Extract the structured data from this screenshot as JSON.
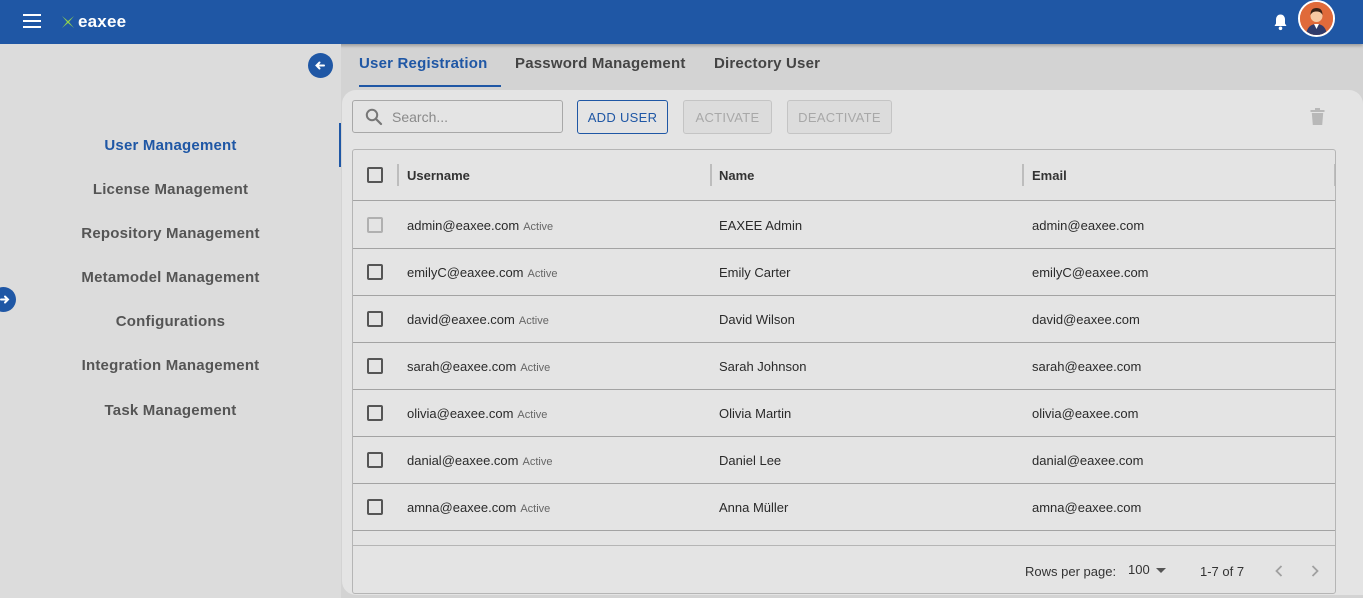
{
  "app": {
    "logo_text": "eaxee",
    "brand_color": "#1f57a5",
    "logo_mark_color": "#8fd14f"
  },
  "topbar": {
    "menu_icon": "hamburger-menu-icon",
    "notifications_icon": "bell-icon",
    "avatar_icon": "user-avatar"
  },
  "sidebar": {
    "items": [
      {
        "label": "User Management",
        "active": true
      },
      {
        "label": "License Management"
      },
      {
        "label": "Repository Management"
      },
      {
        "label": "Metamodel Management"
      },
      {
        "label": "Configurations"
      },
      {
        "label": "Integration Management"
      },
      {
        "label": "Task Management"
      }
    ]
  },
  "tabs": [
    {
      "label": "User Registration",
      "active": true
    },
    {
      "label": "Password Management"
    },
    {
      "label": "Directory User"
    }
  ],
  "toolbar": {
    "search_placeholder": "Search...",
    "add_user": "ADD USER",
    "activate": "ACTIVATE",
    "deactivate": "DEACTIVATE",
    "delete_icon": "trash-icon"
  },
  "table": {
    "columns": [
      "Username",
      "Name",
      "Email"
    ],
    "rows": [
      {
        "username": "admin@eaxee.com",
        "status": "Active",
        "name": "EAXEE Admin",
        "email": "admin@eaxee.com",
        "checkbox_disabled": true
      },
      {
        "username": "emilyC@eaxee.com",
        "status": "Active",
        "name": "Emily Carter",
        "email": "emilyC@eaxee.com"
      },
      {
        "username": "david@eaxee.com",
        "status": "Active",
        "name": "David Wilson",
        "email": "david@eaxee.com"
      },
      {
        "username": "sarah@eaxee.com",
        "status": "Active",
        "name": "Sarah Johnson",
        "email": "sarah@eaxee.com"
      },
      {
        "username": "olivia@eaxee.com",
        "status": "Active",
        "name": "Olivia Martin",
        "email": "olivia@eaxee.com"
      },
      {
        "username": "danial@eaxee.com",
        "status": "Active",
        "name": "Daniel Lee",
        "email": "danial@eaxee.com"
      },
      {
        "username": "amna@eaxee.com",
        "status": "Active",
        "name": "Anna Müller",
        "email": "amna@eaxee.com"
      }
    ]
  },
  "pagination": {
    "rows_per_page_label": "Rows per page:",
    "rows_per_page": "100",
    "range": "1-7 of 7"
  }
}
